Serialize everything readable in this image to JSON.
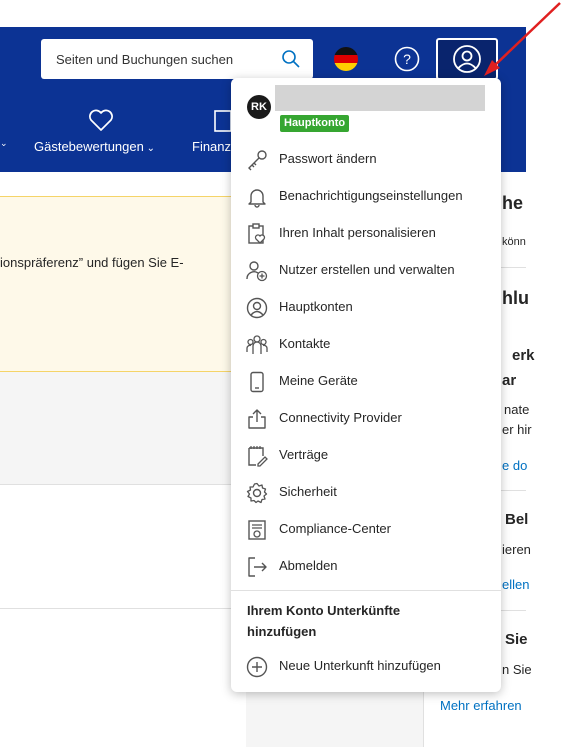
{
  "header": {
    "search_placeholder": "Seiten und Buchungen suchen",
    "nav": [
      {
        "label": "Gästebewertungen",
        "icon": "heart-icon"
      },
      {
        "label": "Finanz",
        "icon": "document-icon"
      }
    ],
    "flag": "germany-flag-icon",
    "help_label": "?"
  },
  "background": {
    "notice_line1": "ionspräferenz” und fügen Sie E-",
    "right_fragments": [
      "he",
      "könn",
      "hlu",
      "erk",
      "ar",
      "nate",
      "er hir",
      "e do",
      "Bel",
      "ieren",
      "ellen",
      "Sie",
      "n Sie",
      "Mehr erfahren"
    ]
  },
  "dropdown": {
    "avatar_initials": "RK",
    "badge": "Hauptkonto",
    "items": [
      {
        "label": "Passwort ändern",
        "icon": "key-icon"
      },
      {
        "label": "Benachrichtigungseinstellungen",
        "icon": "bell-icon"
      },
      {
        "label": "Ihren Inhalt personalisieren",
        "icon": "clipboard-heart-icon"
      },
      {
        "label": "Nutzer erstellen und verwalten",
        "icon": "user-add-icon"
      },
      {
        "label": "Hauptkonten",
        "icon": "user-circle-icon"
      },
      {
        "label": "Kontakte",
        "icon": "people-icon"
      },
      {
        "label": "Meine Geräte",
        "icon": "phone-icon"
      },
      {
        "label": "Connectivity Provider",
        "icon": "share-icon"
      },
      {
        "label": "Verträge",
        "icon": "contract-icon"
      },
      {
        "label": "Sicherheit",
        "icon": "gear-icon"
      },
      {
        "label": "Compliance-Center",
        "icon": "compliance-icon"
      },
      {
        "label": "Abmelden",
        "icon": "logout-icon"
      }
    ],
    "section_title": "Ihrem Konto Unterkünfte hinzufügen",
    "add_property_label": "Neue Unterkunft hinzufügen"
  },
  "colors": {
    "header_bg": "#0c3394",
    "badge_green": "#36a631",
    "arrow_red": "#e02020",
    "link_blue": "#0071c2"
  }
}
